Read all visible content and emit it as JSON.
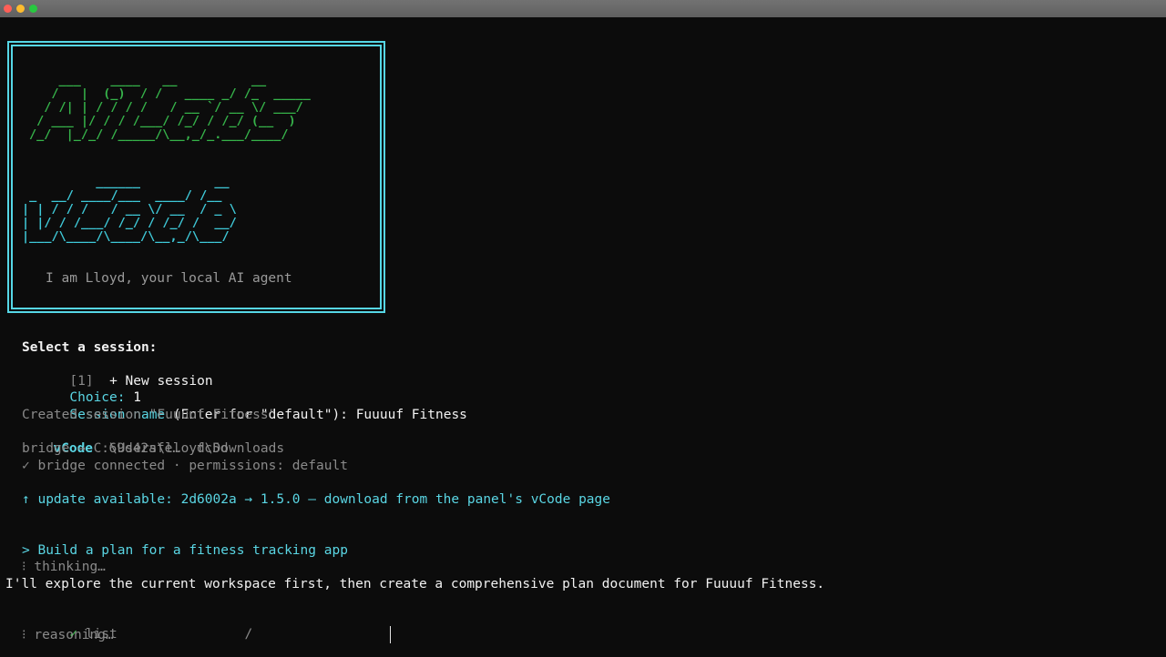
{
  "window": {
    "traffic_lights": [
      "close",
      "minimize",
      "maximize"
    ]
  },
  "banner": {
    "art_ai_labs": "    ___    ____   __          __\n   /   |  (_)  / /   ____ _/ /_  _____\n  / /| | / / / /   / __ `/ __ \\/ ___/\n / ___ |/ / / /___/ /_/ / /_/ (__  )\n/_/  |_/_/ /_____/\\__,_/_.___/____/",
    "art_vcode": "          ______          __\n _  __/ ____/___  ____/ /__\n| | / / /   / __ \\/ __  / _ \\\n| |/ / /___/ /_/ / /_/ /  __/\n|___/\\____/\\____/\\__,_/\\___/",
    "tagline": "I am Lloyd, your local AI agent"
  },
  "session": {
    "select_prompt": "Select a session:",
    "option_number": "[1]",
    "option_label": "+ New session",
    "choice_label": "Choice:",
    "choice_value": "1",
    "name_label": "Session name",
    "name_hint": "(Enter for \"default\"):",
    "name_value": "Fuuuuf Fitness",
    "created_message": "Created session \"Fuuuuf Fitness\""
  },
  "status": {
    "app_name": "vCode",
    "session_id": "69d42afe…",
    "short_id": "fc5d",
    "bridge_path": "bridge → C:\\Users\\lloyd\\Downloads",
    "bridge_connected": "✓ bridge connected · permissions: default",
    "update_notice": "↑ update available: 2d6002a → 1.5.0 — download from the panel's vCode page"
  },
  "conversation": {
    "user_prompt": "> Build a plan for a fitness tracking app",
    "thinking": "⁝ thinking…",
    "assistant_message": "I'll explore the current workspace first, then create a comprehensive plan document for Fuuuuf Fitness.",
    "tool_check": "✓",
    "tool_name": "list",
    "tool_arg": "/",
    "reasoning": "⁝ reasoning…"
  },
  "colors": {
    "background": "#0c0c0c",
    "cyan": "#5ad6e4",
    "green": "#3fc650",
    "gray": "#8a8a8a",
    "frame": "#56d7e6"
  }
}
